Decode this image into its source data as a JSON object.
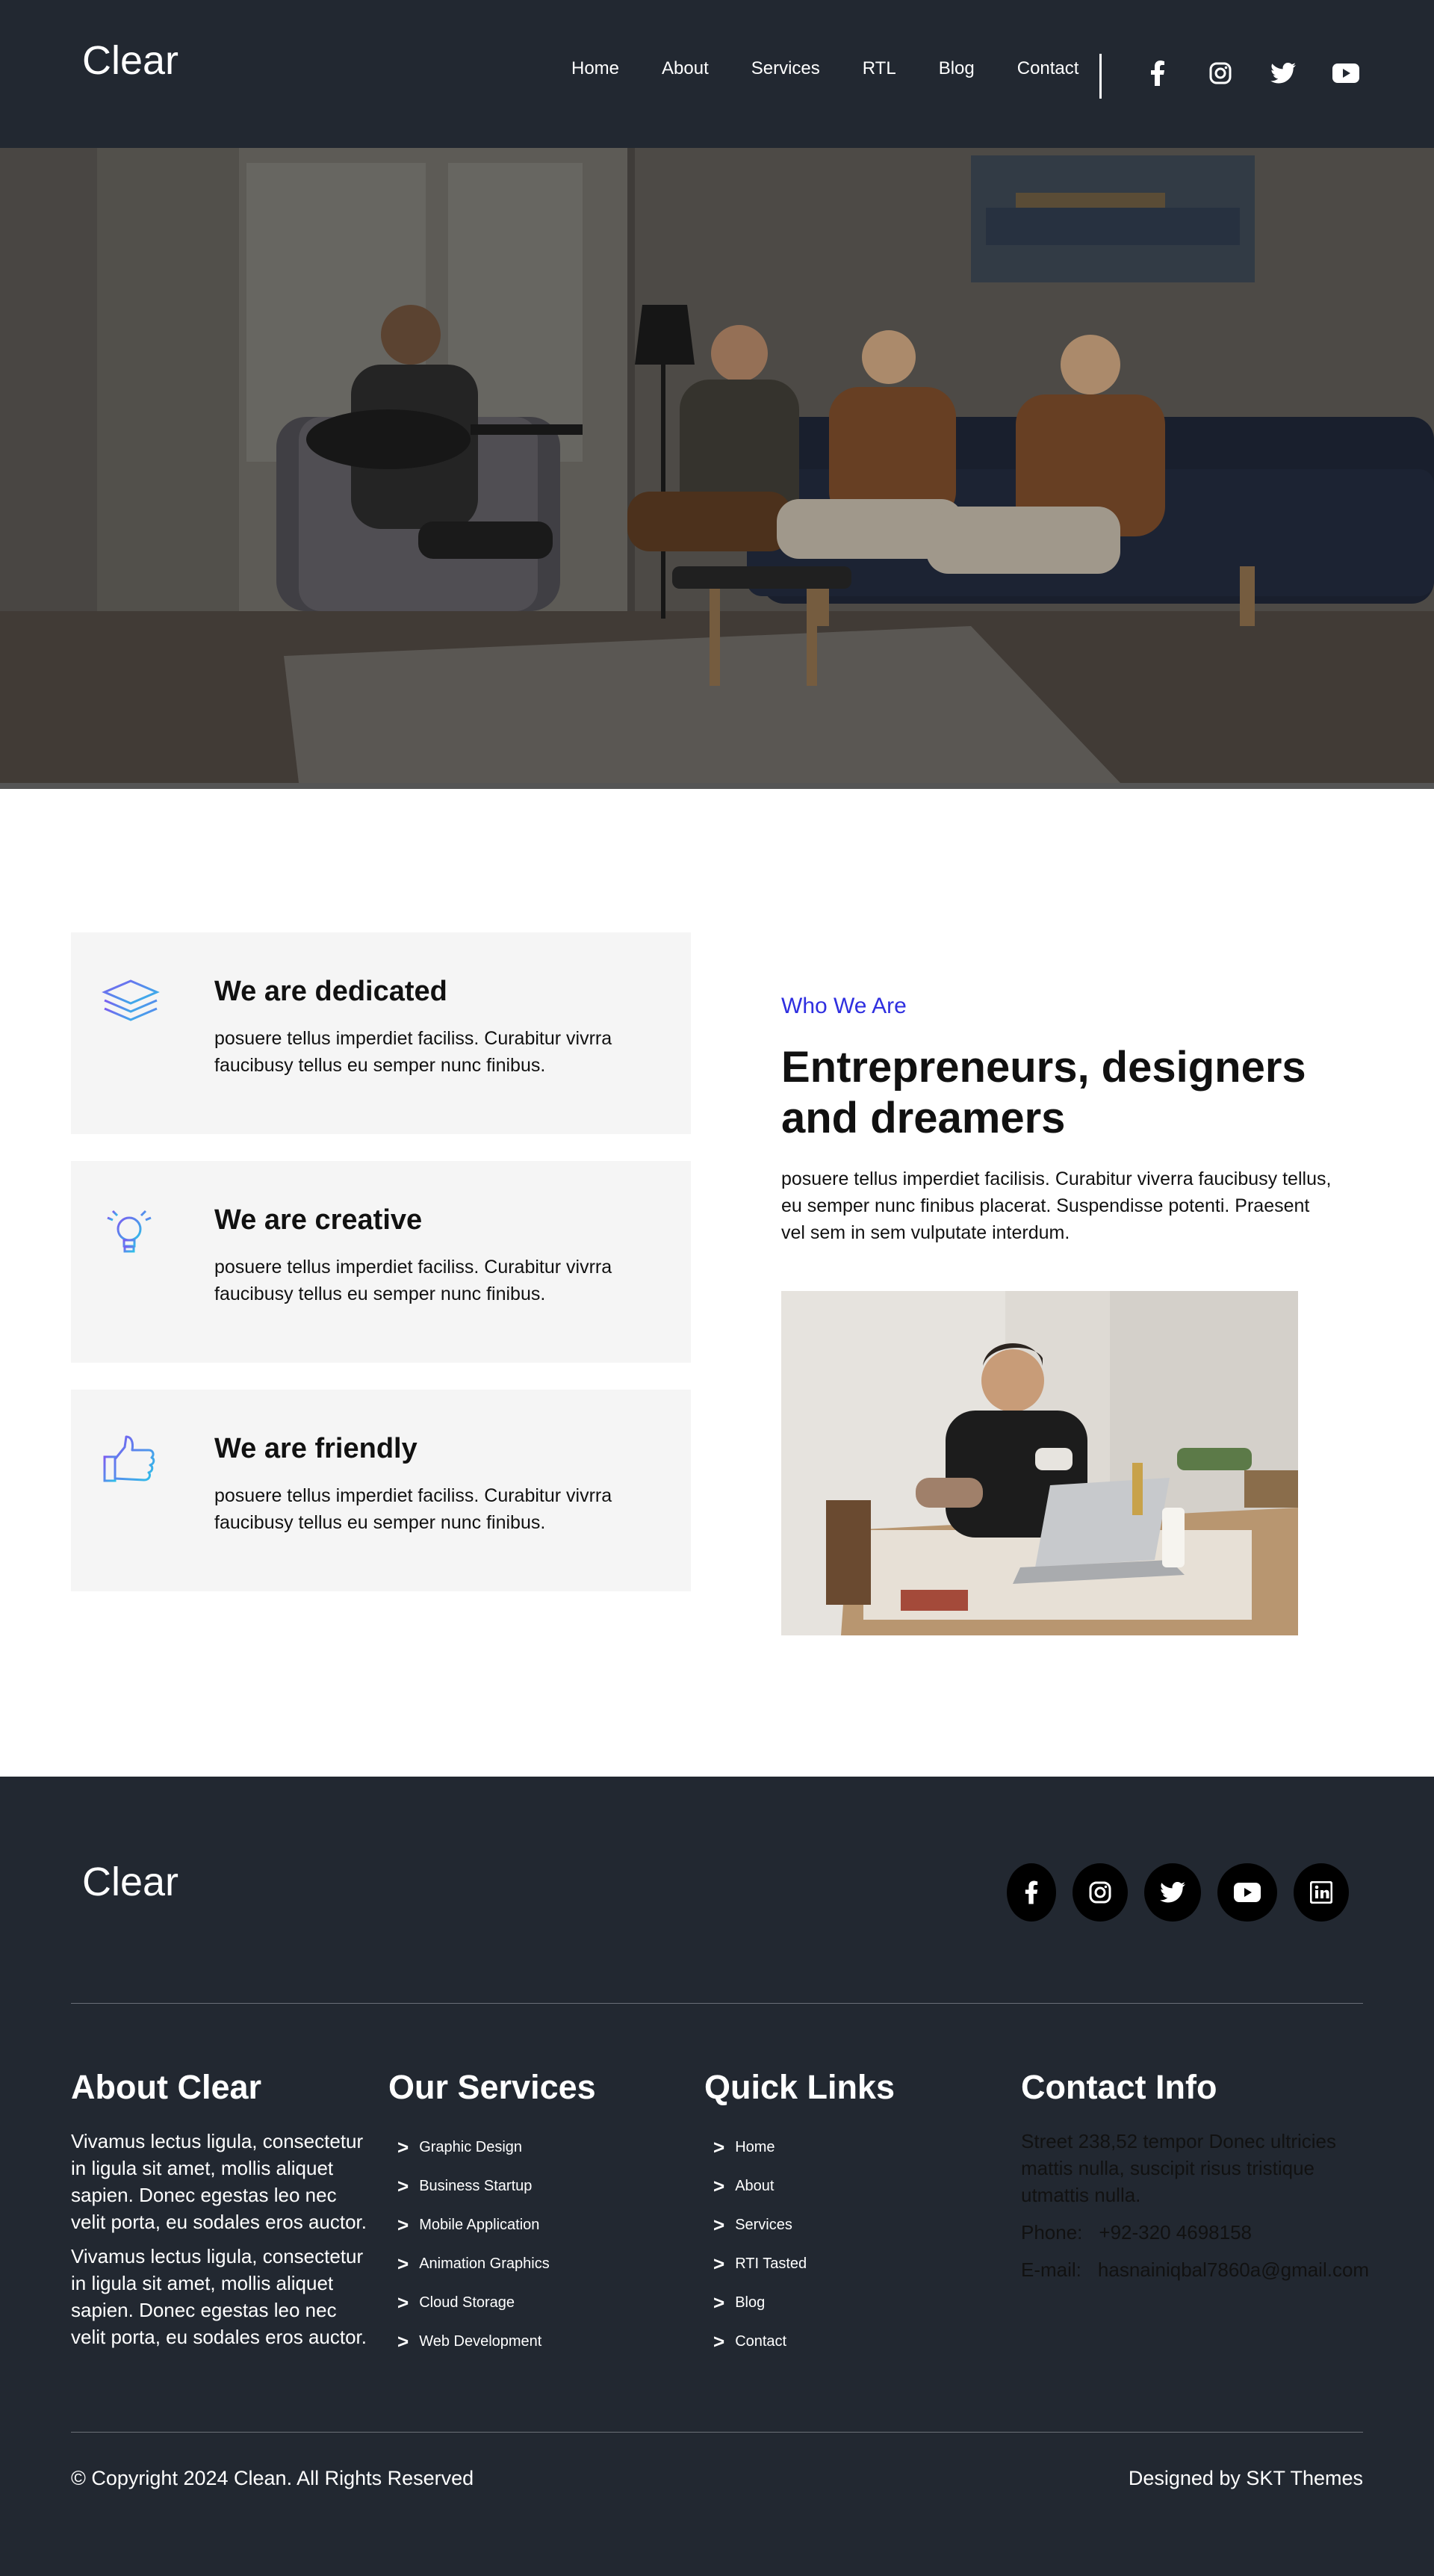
{
  "header": {
    "logo": "Clear",
    "nav": [
      "Home",
      "About",
      "Services",
      "RTL",
      "Blog",
      "Contact"
    ],
    "social_icons": [
      "facebook-icon",
      "instagram-icon",
      "twitter-icon",
      "youtube-icon"
    ]
  },
  "features": [
    {
      "icon": "layers-icon",
      "title": "We are dedicated",
      "text": "posuere tellus imperdiet faciliss. Curabitur vivrra faucibusy tellus eu semper nunc finibus."
    },
    {
      "icon": "lightbulb-icon",
      "title": "We are creative",
      "text": "posuere tellus imperdiet faciliss. Curabitur vivrra faucibusy tellus eu semper nunc finibus."
    },
    {
      "icon": "thumbs-up-icon",
      "title": "We are friendly",
      "text": "posuere tellus imperdiet faciliss. Curabitur vivrra faucibusy tellus eu semper nunc finibus."
    }
  ],
  "about": {
    "eyebrow": "Who We Are",
    "headline": "Entrepreneurs, designers and dreamers",
    "text": "posuere tellus imperdiet facilisis. Curabitur viverra faucibusy tellus, eu semper nunc finibus placerat. Suspendisse potenti. Praesent vel sem in sem vulputate interdum."
  },
  "footer": {
    "logo": "Clear",
    "social_icons": [
      "facebook-icon",
      "instagram-icon",
      "twitter-icon",
      "youtube-icon",
      "linkedin-icon"
    ],
    "about_title": "About Clear",
    "about_paragraphs": [
      "Vivamus lectus ligula, consectetur in ligula sit amet, mollis aliquet sapien. Donec egestas leo nec velit porta, eu sodales eros auctor.",
      "Vivamus lectus ligula, consectetur in ligula sit amet, mollis aliquet sapien. Donec egestas leo nec velit porta, eu sodales eros auctor."
    ],
    "services_title": "Our Services",
    "services": [
      "Graphic Design",
      "Business Startup",
      "Mobile Application",
      "Animation Graphics",
      "Cloud Storage",
      "Web Development"
    ],
    "links_title": "Quick Links",
    "links": [
      "Home",
      "About",
      "Services",
      "RTI Tasted",
      "Blog",
      "Contact"
    ],
    "contact_title": "Contact Info",
    "contact_address": "Street 238,52 tempor Donec ultricies mattis nulla, suscipit risus tristique utmattis nulla.",
    "phone_label": "Phone:",
    "phone": "+92-320 4698158",
    "email_label": "E-mail:",
    "email": "hasnainiqbal7860a@gmail.com",
    "copyright": "© Copyright 2024 Clean. All Rights Reserved",
    "designed_by": "Designed by SKT Themes"
  },
  "colors": {
    "header_bg": "#222831",
    "accent": "#2f2fe0",
    "card_bg": "#f5f5f5"
  }
}
